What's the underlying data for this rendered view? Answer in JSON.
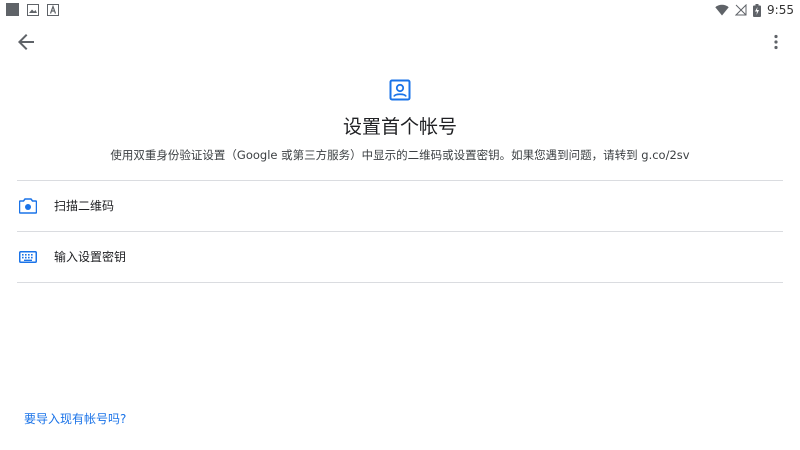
{
  "status_bar": {
    "time": "9:55"
  },
  "header": {
    "title": "设置首个帐号",
    "description": "使用双重身份验证设置（Google 或第三方服务）中显示的二维码或设置密钥。如果您遇到问题，请转到 g.co/2sv"
  },
  "options": [
    {
      "label": "扫描二维码",
      "icon": "camera-icon"
    },
    {
      "label": "输入设置密钥",
      "icon": "keyboard-icon"
    }
  ],
  "footer": {
    "import_link": "要导入现有帐号吗?"
  },
  "colors": {
    "accent": "#1a73e8",
    "text_primary": "#202124",
    "divider": "#dadce0"
  }
}
